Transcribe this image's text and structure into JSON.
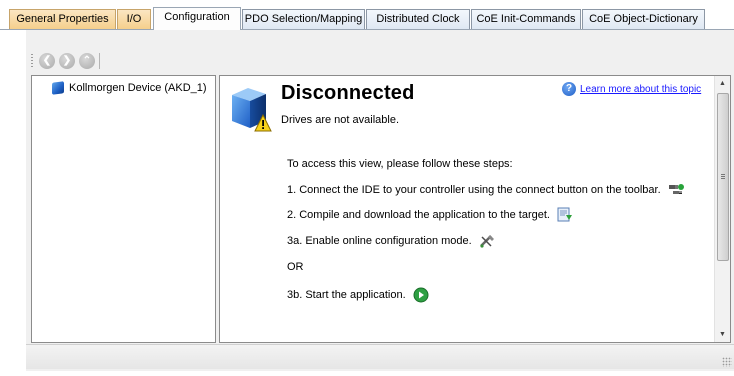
{
  "tabs": [
    {
      "label": "General Properties",
      "style": "orange"
    },
    {
      "label": "I/O",
      "style": "orange"
    },
    {
      "label": "Configuration",
      "style": "active"
    },
    {
      "label": "PDO Selection/Mapping",
      "style": "normal"
    },
    {
      "label": "Distributed Clock",
      "style": "normal"
    },
    {
      "label": "CoE Init-Commands",
      "style": "normal"
    },
    {
      "label": "CoE Object-Dictionary",
      "style": "normal"
    }
  ],
  "toolbar": {
    "back_icon": "back-arrow-icon",
    "forward_icon": "forward-arrow-icon",
    "up_icon": "up-arrow-icon"
  },
  "tree": {
    "items": [
      {
        "label": "Kollmorgen Device (AKD_1)",
        "icon": "device-cube-icon"
      }
    ]
  },
  "content": {
    "title": "Disconnected",
    "subtitle": "Drives are not available.",
    "help_link": "Learn more about this topic",
    "intro": "To access this view, please follow these steps:",
    "steps": [
      {
        "text": "1. Connect the IDE to your controller using the connect button on the toolbar.",
        "icon": "connect-plug-icon"
      },
      {
        "text": "2. Compile and download the application to the target.",
        "icon": "download-icon"
      },
      {
        "text": "3a. Enable online configuration mode.",
        "icon": "online-config-icon"
      },
      {
        "text": "OR",
        "icon": ""
      },
      {
        "text": "3b. Start the application.",
        "icon": "play-icon"
      }
    ]
  },
  "colors": {
    "orange_tab": "#f5cf8c",
    "link": "#1a1aff",
    "accent_blue": "#1d5fc4"
  }
}
